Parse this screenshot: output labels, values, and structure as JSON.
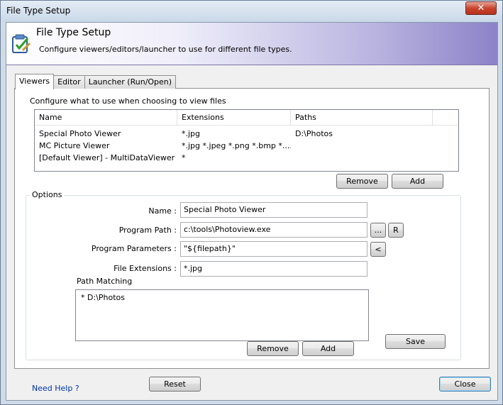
{
  "window": {
    "title": "File Type Setup",
    "close_glyph": "✕"
  },
  "banner": {
    "icon": "checklist-icon",
    "title": "File Type Setup",
    "subtitle": "Configure viewers/editors/launcher to use for different file types."
  },
  "tabs": [
    {
      "label": "Viewers",
      "active": true
    },
    {
      "label": "Editor",
      "active": false
    },
    {
      "label": "Launcher (Run/Open)",
      "active": false
    }
  ],
  "viewers": {
    "hint": "Configure what to use when choosing to view files",
    "columns": [
      "Name",
      "Extensions",
      "Paths"
    ],
    "rows": [
      {
        "name": "Special Photo Viewer",
        "extensions": "*.jpg",
        "paths": "D:\\Photos"
      },
      {
        "name": "MC Picture Viewer",
        "extensions": "*.jpg *.jpeg *.png *.bmp *....",
        "paths": ""
      },
      {
        "name": "[Default Viewer] - MultiDataViewer",
        "extensions": "*",
        "paths": ""
      }
    ],
    "remove_label": "Remove",
    "add_label": "Add"
  },
  "options": {
    "group_label": "Options",
    "name_label": "Name :",
    "name_value": "Special Photo Viewer",
    "program_path_label": "Program Path :",
    "program_path_value": "c:\\tools\\Photoview.exe",
    "browse_label": "...",
    "r_label": "R",
    "params_label": "Program Parameters :",
    "params_value": "\"${filepath}\"",
    "insert_label": "<",
    "ext_label": "File Extensions :",
    "ext_value": "*.jpg",
    "path_matching_label": "Path Matching",
    "path_items": [
      "*   D:\\Photos"
    ],
    "path_remove_label": "Remove",
    "path_add_label": "Add",
    "save_label": "Save"
  },
  "footer": {
    "help_label": "Need Help ?",
    "reset_label": "Reset",
    "close_label": "Close"
  }
}
